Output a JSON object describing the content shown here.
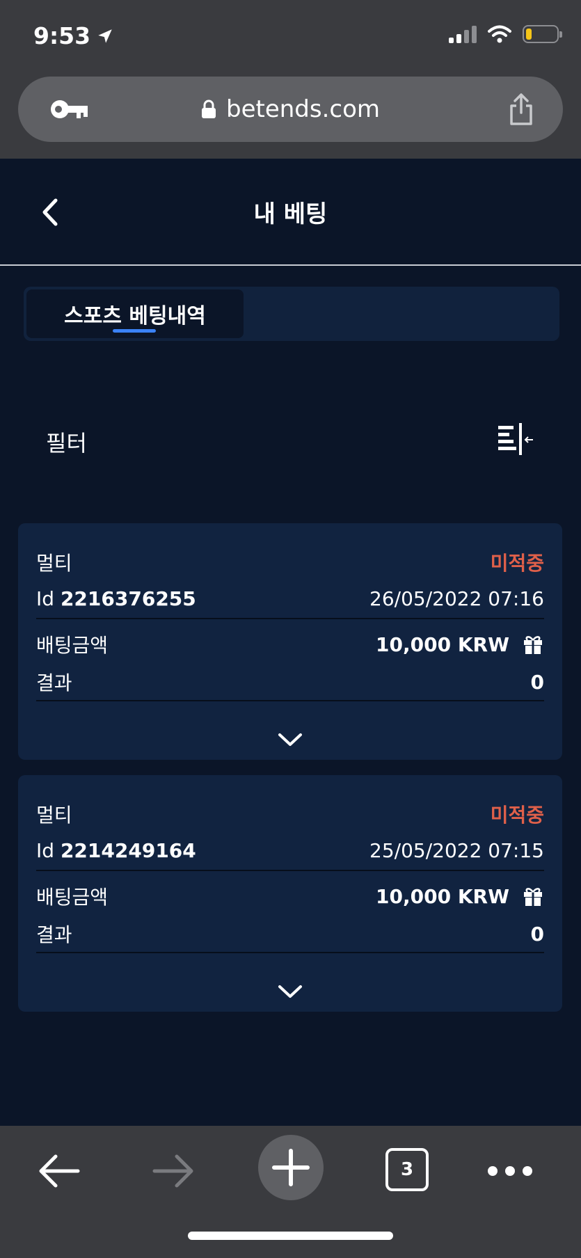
{
  "status_bar": {
    "time": "9:53"
  },
  "browser": {
    "url": "betends.com",
    "tab_count": "3"
  },
  "header": {
    "title": "내 베팅"
  },
  "tabs": [
    {
      "label": "스포츠 베팅내역"
    }
  ],
  "filter": {
    "label": "필터"
  },
  "bets": [
    {
      "type": "멀티",
      "status": "미적중",
      "id_label": "Id",
      "id": "2216376255",
      "date": "26/05/2022 07:16",
      "stake_label": "배팅금액",
      "stake": "10,000 KRW",
      "result_label": "결과",
      "result": "0"
    },
    {
      "type": "멀티",
      "status": "미적중",
      "id_label": "Id",
      "id": "2214249164",
      "date": "25/05/2022 07:15",
      "stake_label": "배팅금액",
      "stake": "10,000 KRW",
      "result_label": "결과",
      "result": "0"
    }
  ],
  "colors": {
    "background": "#0b1528",
    "card": "#112340",
    "status_lost": "#e0604a",
    "accent": "#3b82f6"
  }
}
